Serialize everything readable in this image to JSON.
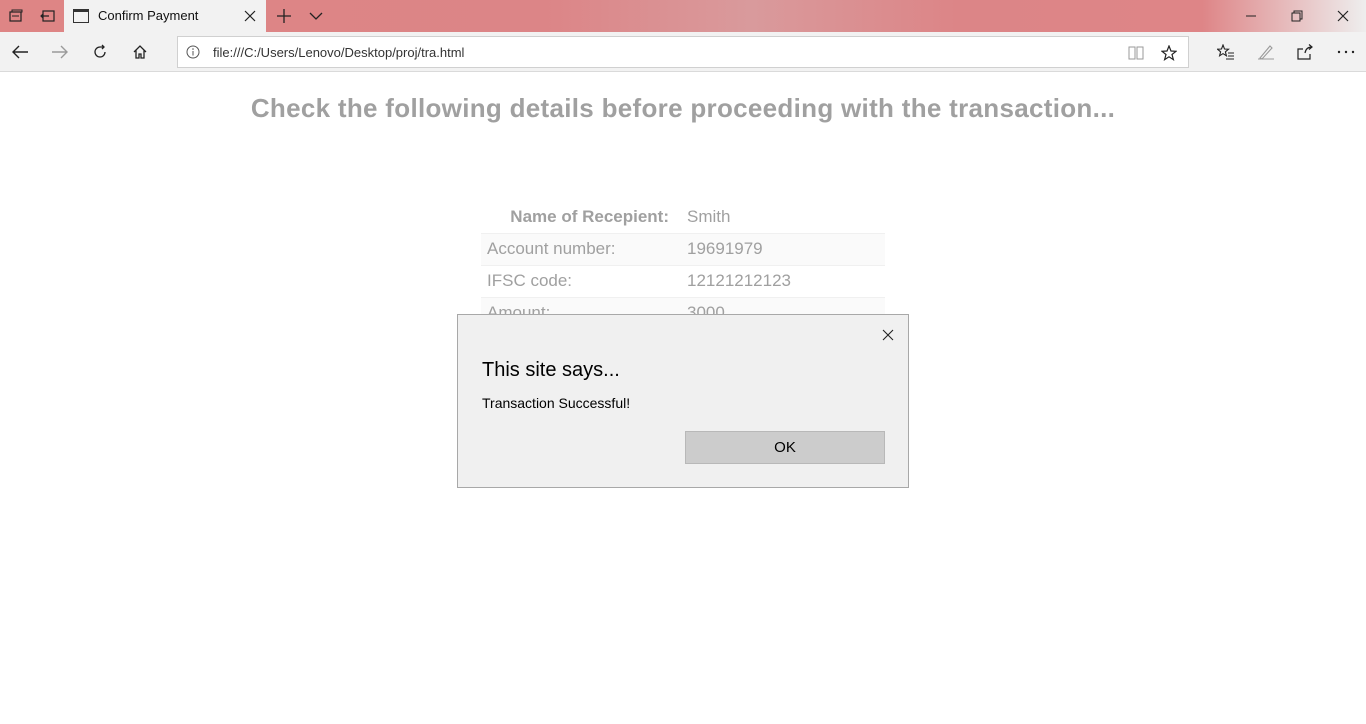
{
  "browser": {
    "tab": {
      "title": "Confirm Payment"
    },
    "address": {
      "url": "file:///C:/Users/Lenovo/Desktop/proj/tra.html"
    },
    "icons": {
      "tab_set_aside": "tabs-aside-icon",
      "tab_restore": "tabs-restore-icon",
      "new_tab": "plus-icon",
      "tab_list": "chevron-down-icon",
      "back": "back-arrow-icon",
      "forward": "forward-arrow-icon",
      "refresh": "refresh-icon",
      "home": "home-icon",
      "reading_view": "book-icon",
      "favorite": "star-icon",
      "favorites_hub": "favorites-list-icon",
      "notes": "pen-icon",
      "share": "share-icon",
      "more": "more-icon"
    }
  },
  "page": {
    "heading": "Check the following details before proceeding with the transaction...",
    "details": [
      {
        "label": "Name of Recepient:",
        "value": "Smith"
      },
      {
        "label": "Account number:",
        "value": "19691979"
      },
      {
        "label": "IFSC code:",
        "value": "12121212123"
      },
      {
        "label": "Amount:",
        "value": "3000"
      }
    ]
  },
  "dialog": {
    "title": "This site says...",
    "message": "Transaction Successful!",
    "ok_label": "OK"
  },
  "colors": {
    "titlebar_accent": "#de8585",
    "page_text": "#a0a0a0",
    "dialog_bg": "#f0f0f0",
    "ok_button": "#cccccc"
  }
}
